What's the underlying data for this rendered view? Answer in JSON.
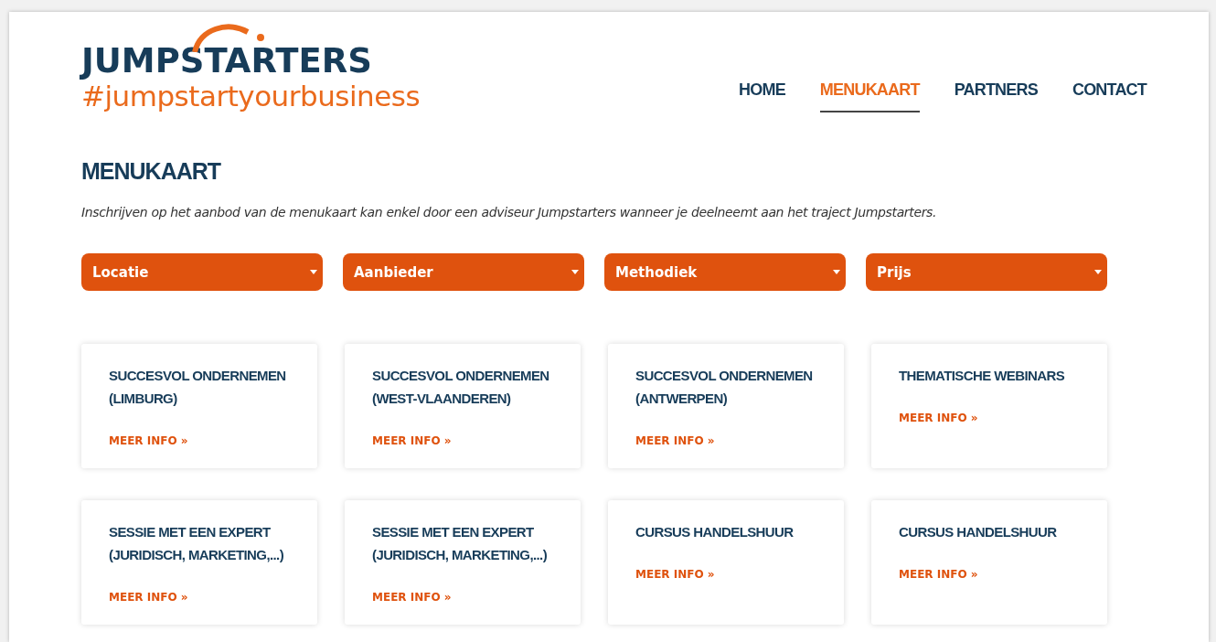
{
  "logo": {
    "name": "JUMPSTARTERS",
    "tagline": "#jumpstartyourbusiness"
  },
  "nav": [
    {
      "label": "HOME",
      "selected": false
    },
    {
      "label": "MENUKAART",
      "selected": true
    },
    {
      "label": "PARTNERS",
      "selected": false
    },
    {
      "label": "CONTACT",
      "selected": false
    }
  ],
  "heading": "MENUKAART",
  "intro": "Inschrijven op het aanbod van de menukaart kan enkel door een adviseur Jumpstarters wanneer je deelneemt aan het traject Jumpstarters.",
  "filters": [
    "Locatie",
    "Aanbieder",
    "Methodiek",
    "Prijs"
  ],
  "cards": [
    {
      "title": "SUCCESVOL ONDERNEMEN (LIMBURG)",
      "link": "MEER INFO »"
    },
    {
      "title": "SUCCESVOL ONDERNEMEN (WEST-VLAANDEREN)",
      "link": "MEER INFO »"
    },
    {
      "title": "SUCCESVOL ONDERNEMEN (ANTWERPEN)",
      "link": "MEER INFO »"
    },
    {
      "title": "THEMATISCHE WEBINARS",
      "link": "MEER INFO »"
    },
    {
      "title": "SESSIE MET EEN EXPERT (JURIDISCH, MARKETING,...)",
      "link": "MEER INFO »"
    },
    {
      "title": "SESSIE MET EEN EXPERT (JURIDISCH, MARKETING,...)",
      "link": "MEER INFO »"
    },
    {
      "title": "CURSUS HANDELSHUUR",
      "link": "MEER INFO »"
    },
    {
      "title": "CURSUS HANDELSHUUR",
      "link": "MEER INFO »"
    }
  ]
}
